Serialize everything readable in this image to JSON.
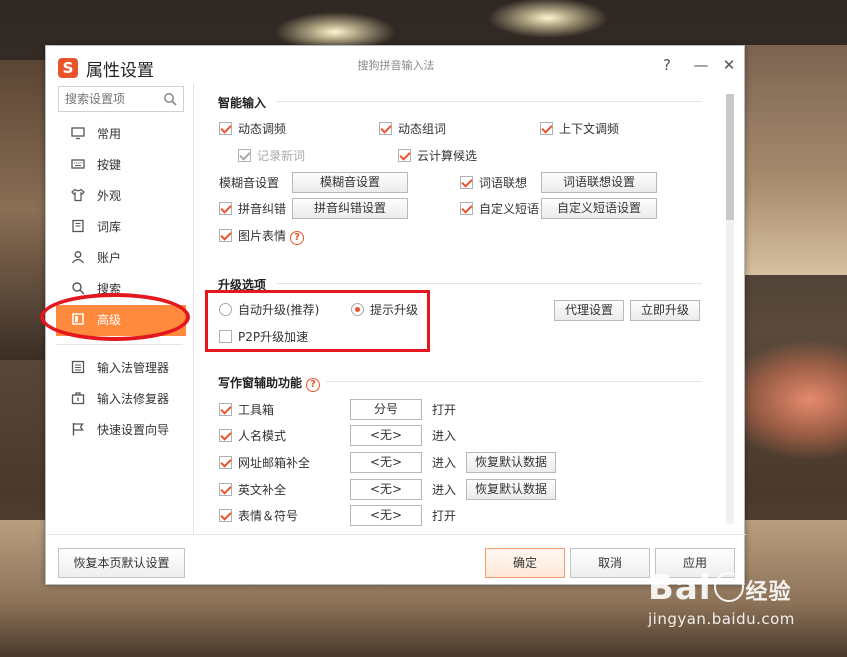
{
  "window": {
    "title": "属性设置",
    "center_title": "搜狗拼音输入法",
    "help_glyph": "?",
    "minimize_glyph": "—",
    "close_glyph": "✕",
    "logo_letter": "S"
  },
  "sidebar": {
    "search_placeholder": "搜索设置项",
    "items": [
      {
        "label": "常用",
        "icon": "monitor-icon"
      },
      {
        "label": "按键",
        "icon": "keyboard-icon"
      },
      {
        "label": "外观",
        "icon": "tshirt-icon"
      },
      {
        "label": "词库",
        "icon": "book-icon"
      },
      {
        "label": "账户",
        "icon": "user-icon"
      },
      {
        "label": "搜索",
        "icon": "search-icon"
      },
      {
        "label": "高级",
        "icon": "advanced-icon",
        "active": true
      }
    ],
    "tools": [
      {
        "label": "输入法管理器",
        "icon": "manager-icon"
      },
      {
        "label": "输入法修复器",
        "icon": "toolbox-icon"
      },
      {
        "label": "快速设置向导",
        "icon": "flag-icon"
      }
    ]
  },
  "smart_input": {
    "title": "智能输入",
    "dynamic_freq": "动态调频",
    "dynamic_phrase": "动态组词",
    "context_freq": "上下文调频",
    "record_new": "记录新词",
    "cloud": "云计算候选",
    "fuzzy_label": "模糊音设置",
    "fuzzy_btn": "模糊音设置",
    "assoc": "词语联想",
    "assoc_btn": "词语联想设置",
    "pinyin_correct": "拼音纠错",
    "pinyin_correct_btn": "拼音纠错设置",
    "custom_phrase": "自定义短语",
    "custom_phrase_btn": "自定义短语设置",
    "emoji": "图片表情"
  },
  "upgrade": {
    "title": "升级选项",
    "auto": "自动升级(推荐)",
    "prompt": "提示升级",
    "p2p": "P2P升级加速",
    "proxy_btn": "代理设置",
    "now_btn": "立即升级"
  },
  "writing": {
    "title": "写作窗辅助功能",
    "rows": [
      {
        "label": "工具箱",
        "key": "分号",
        "action": "打开",
        "restore": ""
      },
      {
        "label": "人名模式",
        "key": "<无>",
        "action": "进入",
        "restore": ""
      },
      {
        "label": "网址邮箱补全",
        "key": "<无>",
        "action": "进入",
        "restore": "恢复默认数据"
      },
      {
        "label": "英文补全",
        "key": "<无>",
        "action": "进入",
        "restore": "恢复默认数据"
      },
      {
        "label": "表情＆符号",
        "key": "<无>",
        "action": "打开",
        "restore": ""
      }
    ]
  },
  "footer": {
    "restore_defaults": "恢复本页默认设置",
    "ok": "确定",
    "cancel": "取消",
    "apply": "应用"
  },
  "watermark": {
    "logo_text_a": "Bai",
    "logo_text_b": "经验",
    "url": "jingyan.baidu.com"
  },
  "colors": {
    "accent": "#ff8a3d",
    "brand": "#e8552d",
    "annotation": "#e3171d"
  }
}
